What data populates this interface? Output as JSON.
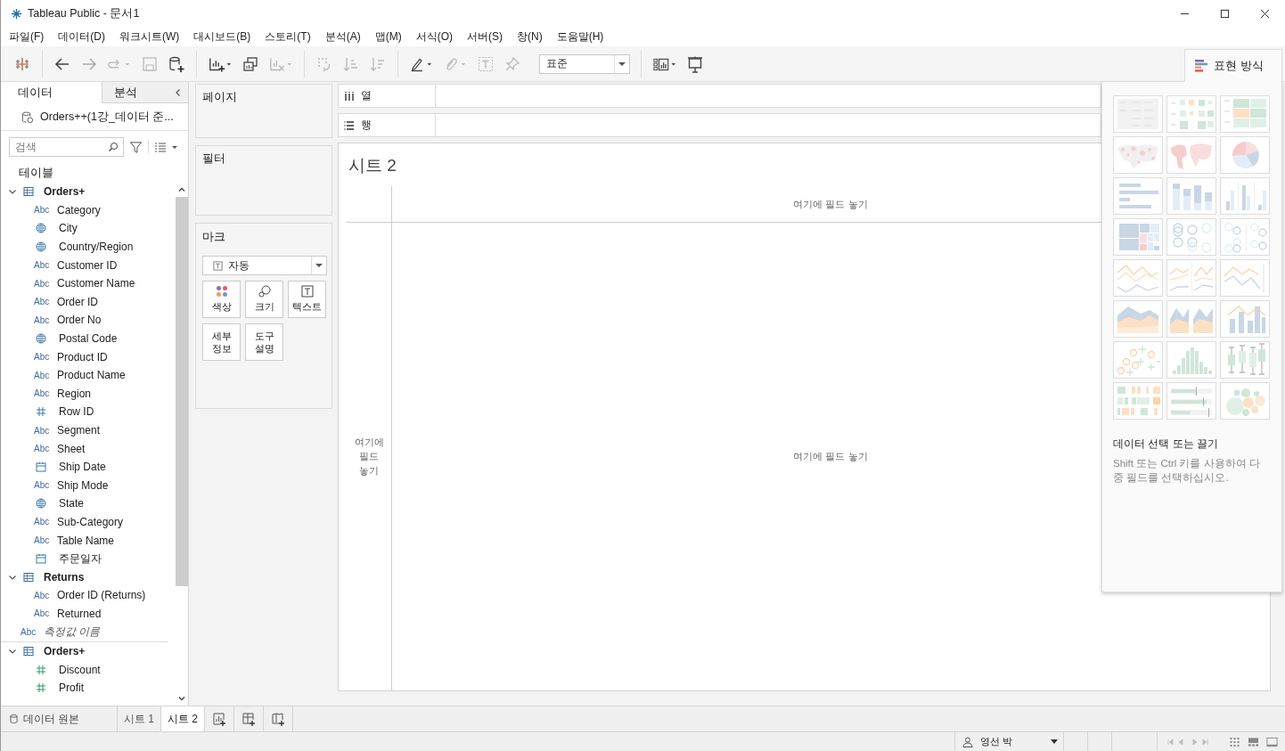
{
  "window": {
    "title": "Tableau Public - 문서1"
  },
  "menu": [
    "파일(F)",
    "데이터(D)",
    "워크시트(W)",
    "대시보드(B)",
    "스토리(T)",
    "분석(A)",
    "맵(M)",
    "서식(O)",
    "서버(S)",
    "창(N)",
    "도움말(H)"
  ],
  "toolbar": {
    "fit_dropdown": "표준"
  },
  "data_pane": {
    "tabs": [
      {
        "label": "데이터",
        "selected": true
      },
      {
        "label": "분석",
        "selected": false
      }
    ],
    "data_source": "Orders++(1강_데이터 준...",
    "search": {
      "placeholder": "검색"
    },
    "tables_heading": "테이블",
    "dimension_tables": [
      {
        "name": "Orders+",
        "expanded": true,
        "children": [
          {
            "name": "Category",
            "kind": "string",
            "type_text": "Abc"
          },
          {
            "name": "City",
            "kind": "geo"
          },
          {
            "name": "Country/Region",
            "kind": "geo"
          },
          {
            "name": "Customer ID",
            "kind": "string",
            "type_text": "Abc"
          },
          {
            "name": "Customer Name",
            "kind": "string",
            "type_text": "Abc"
          },
          {
            "name": "Order ID",
            "kind": "string",
            "type_text": "Abc"
          },
          {
            "name": "Order No",
            "kind": "string",
            "type_text": "Abc"
          },
          {
            "name": "Postal Code",
            "kind": "geo"
          },
          {
            "name": "Product ID",
            "kind": "string",
            "type_text": "Abc"
          },
          {
            "name": "Product Name",
            "kind": "string",
            "type_text": "Abc"
          },
          {
            "name": "Region",
            "kind": "string",
            "type_text": "Abc"
          },
          {
            "name": "Row ID",
            "kind": "number"
          },
          {
            "name": "Segment",
            "kind": "string",
            "type_text": "Abc"
          },
          {
            "name": "Sheet",
            "kind": "string",
            "type_text": "Abc"
          },
          {
            "name": "Ship Date",
            "kind": "date"
          },
          {
            "name": "Ship Mode",
            "kind": "string",
            "type_text": "Abc"
          },
          {
            "name": "State",
            "kind": "geo"
          },
          {
            "name": "Sub-Category",
            "kind": "string",
            "type_text": "Abc"
          },
          {
            "name": "Table Name",
            "kind": "string",
            "type_text": "Abc"
          },
          {
            "name": "주문일자",
            "kind": "date"
          }
        ]
      },
      {
        "name": "Returns",
        "expanded": true,
        "children": [
          {
            "name": "Order ID (Returns)",
            "kind": "string",
            "type_text": "Abc"
          },
          {
            "name": "Returned",
            "kind": "string",
            "type_text": "Abc"
          }
        ]
      }
    ],
    "measure_names": {
      "name": "측정값 이름",
      "type_text": "Abc"
    },
    "measure_tables": [
      {
        "name": "Orders+",
        "expanded": true,
        "children": [
          {
            "name": "Discount",
            "kind": "number"
          },
          {
            "name": "Profit",
            "kind": "number"
          }
        ]
      }
    ]
  },
  "cards": {
    "pages": "페이지",
    "filters": "필터",
    "marks": {
      "title": "마크",
      "mark_type": "자동",
      "buttons": [
        {
          "label": "색상",
          "kind": "color"
        },
        {
          "label": "크기",
          "kind": "size"
        },
        {
          "label": "텍스트",
          "kind": "text"
        },
        {
          "label": "세부 정보",
          "kind": "detail"
        },
        {
          "label": "도구 설명",
          "kind": "tooltip"
        }
      ]
    }
  },
  "shelves": {
    "columns": "열",
    "rows": "행"
  },
  "sheet": {
    "title": "시트 2",
    "column_drop": "여기에 필드 놓기",
    "row_drop": "여기에 필드 놓기",
    "body_drop": "여기에 필드 놓기"
  },
  "show_me": {
    "tab": "표현 방식",
    "hint_title": "데이터 선택 또는 끌기",
    "hint_text": "Shift 또는 Ctrl 키를 사용하여 다중 필드를 선택하십시오."
  },
  "sheet_tabs": {
    "data_source": "데이터 원본",
    "sheets": [
      {
        "label": "시트 1",
        "selected": false
      },
      {
        "label": "시트 2",
        "selected": true
      }
    ]
  },
  "status_bar": {
    "user": "영선 박"
  }
}
